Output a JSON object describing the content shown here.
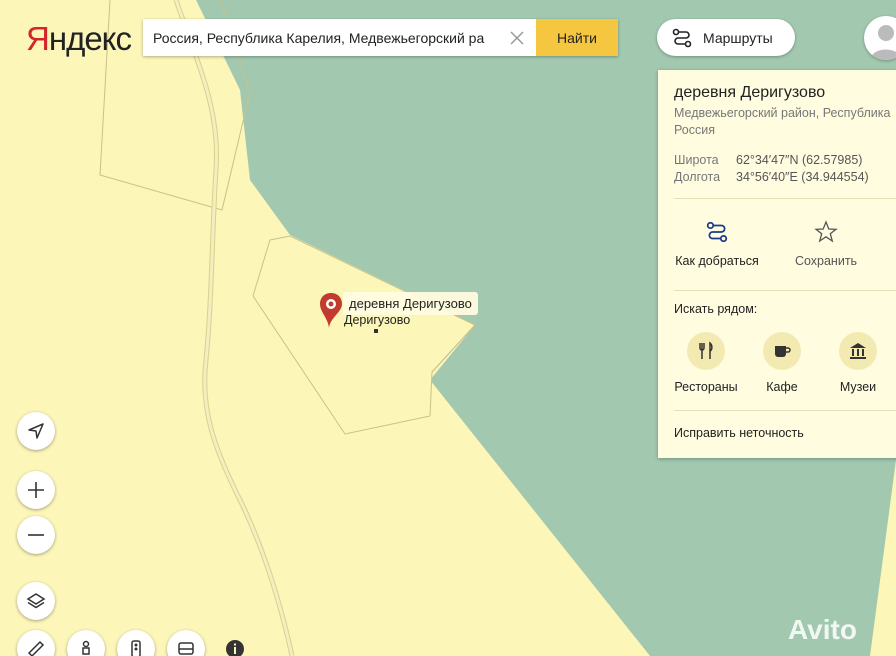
{
  "brand": {
    "logo_first": "Я",
    "logo_rest": "ндекс"
  },
  "search": {
    "value": "Россия, Республика Карелия, Медвежьегорский ра",
    "button": "Найти"
  },
  "routes_button": "Маршруты",
  "panel": {
    "title": "деревня Деригузово",
    "subtitle_line1": "Медвежьегорский район, Республика",
    "subtitle_line2": "Россия",
    "lat_label": "Широта",
    "lat_value": "62°34′47″N (62.57985)",
    "lon_label": "Долгота",
    "lon_value": "34°56′40″E (34.944554)",
    "actions": [
      {
        "label": "Как добраться",
        "icon": "route-icon"
      },
      {
        "label": "Сохранить",
        "icon": "star-icon"
      }
    ],
    "nearby_label": "Искать рядом:",
    "categories": [
      {
        "label": "Рестораны",
        "icon": "fork-knife-icon"
      },
      {
        "label": "Кафе",
        "icon": "cup-icon"
      },
      {
        "label": "Музеи",
        "icon": "museum-icon"
      }
    ],
    "fix_link": "Исправить неточность"
  },
  "map": {
    "place_label": "деревня Деригузово",
    "village_label": "Деригузово",
    "colors": {
      "land": "#fcf6b9",
      "water": "#a2c9b0",
      "road": "#e8dfa0",
      "pin": "#c23b2f",
      "accent": "#f5c740"
    }
  },
  "controls": [
    "locate-icon",
    "zoom-in-icon",
    "zoom-out-icon",
    "layers-icon",
    "ruler-icon",
    "panorama-icon",
    "traffic-icon",
    "transport-icon",
    "info-icon"
  ],
  "watermark": "Avito"
}
